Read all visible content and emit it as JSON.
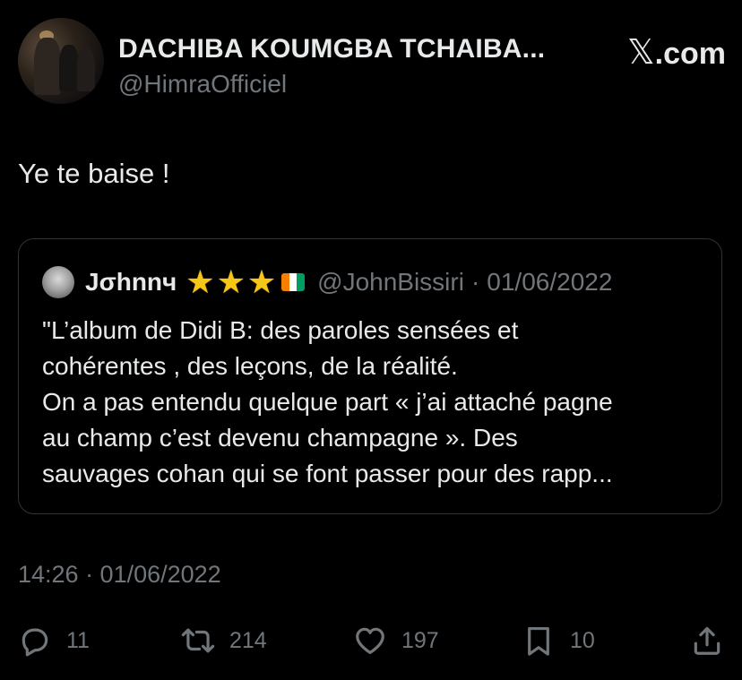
{
  "author": {
    "display_name": "DACHIBA KOUMGBA TCHAIBA...",
    "handle": "@HimraOfficiel",
    "avatar_icon": "profile-photo"
  },
  "branding": {
    "logo_glyph": "𝕏",
    "logo_suffix": ".com"
  },
  "tweet": {
    "text": "Ye te baise !"
  },
  "quoted_tweet": {
    "name": "Jσhnnч",
    "stars": [
      "★",
      "★",
      "★"
    ],
    "flag_colors": [
      "#F77F00",
      "#FFFFFF",
      "#009E60"
    ],
    "handle": "@JohnBissiri",
    "separator": "·",
    "date": "01/06/2022",
    "lines": [
      "\"L’album de Didi B: des paroles sensées et",
      "cohérentes , des leçons, de la réalité.",
      "On a pas entendu quelque part «  j’ai attaché pagne",
      "au champ c’est devenu champagne ». Des",
      "sauvages cohan qui se font passer pour des rapp..."
    ]
  },
  "timestamp": "14:26 · 01/06/2022",
  "actions": {
    "reply_count": "11",
    "retweet_count": "214",
    "like_count": "197",
    "bookmark_count": "10"
  },
  "colors": {
    "background": "#000000",
    "text_primary": "#e7e9ea",
    "text_secondary": "#71767b",
    "border": "#2f3336"
  }
}
